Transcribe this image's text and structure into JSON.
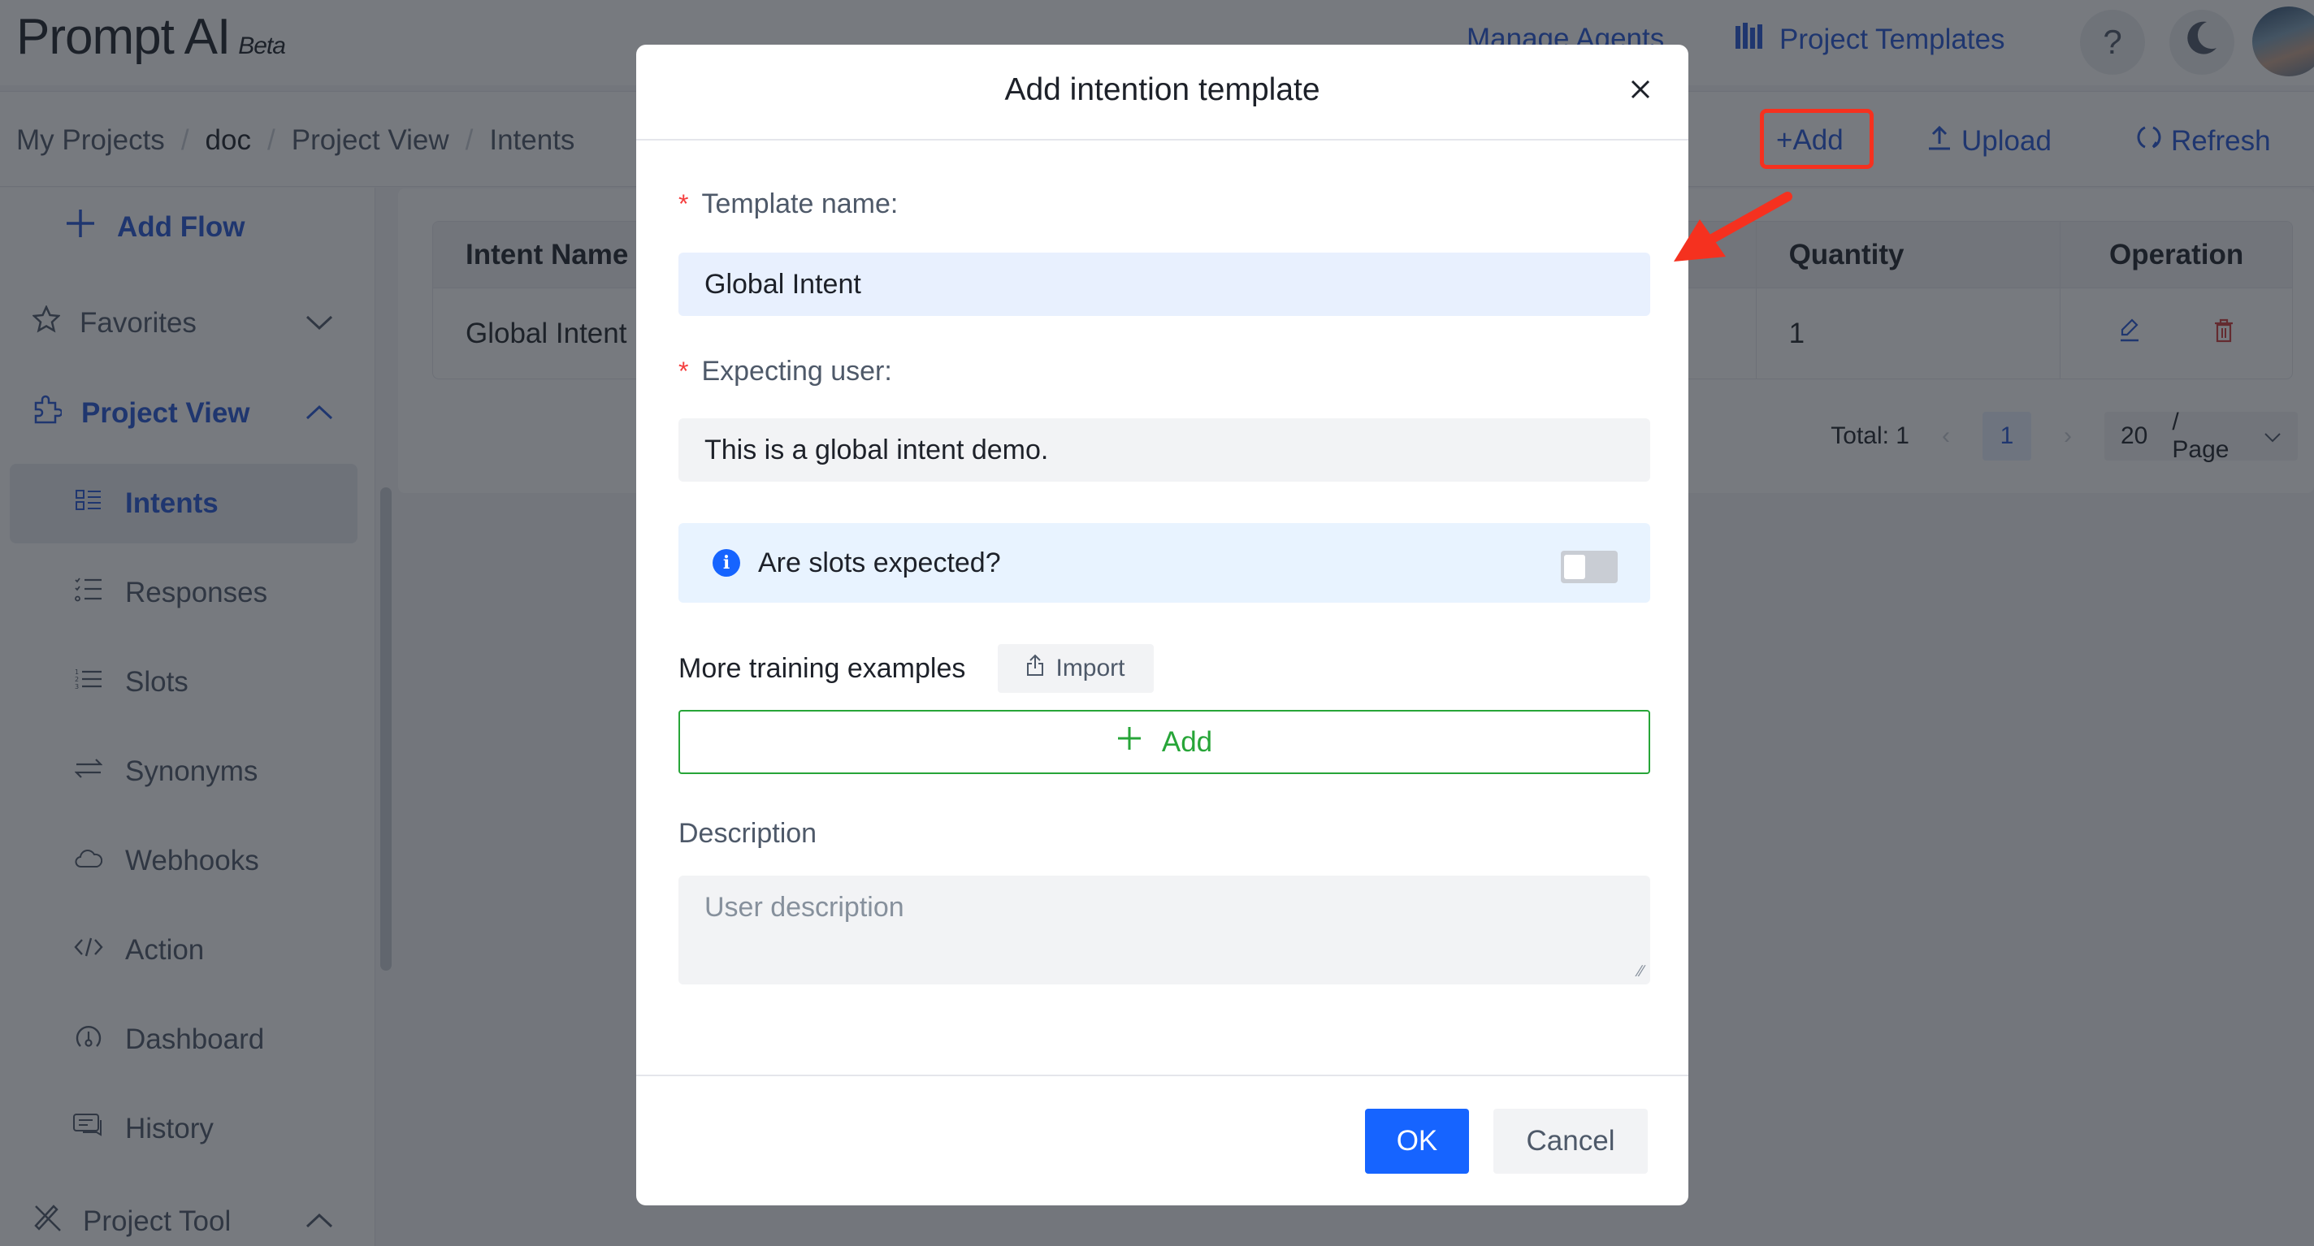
{
  "app": {
    "name": "Prompt AI",
    "badge": "Beta"
  },
  "header": {
    "manage_agents": "Manage Agents",
    "project_templates": "Project Templates",
    "help_icon": "?",
    "theme_icon": "moon-icon"
  },
  "breadcrumb": [
    "My Projects",
    "doc",
    "Project View",
    "Intents"
  ],
  "toolbar": {
    "add": "+Add",
    "upload": "Upload",
    "refresh": "Refresh"
  },
  "sidebar": {
    "add_flow": "Add Flow",
    "favorites": "Favorites",
    "project_view": "Project View",
    "items": [
      {
        "label": "Intents",
        "icon": "intents-icon",
        "active": true
      },
      {
        "label": "Responses",
        "icon": "responses-icon",
        "active": false
      },
      {
        "label": "Slots",
        "icon": "slots-icon",
        "active": false
      },
      {
        "label": "Synonyms",
        "icon": "synonyms-icon",
        "active": false
      },
      {
        "label": "Webhooks",
        "icon": "cloud-icon",
        "active": false
      },
      {
        "label": "Action",
        "icon": "code-icon",
        "active": false
      },
      {
        "label": "Dashboard",
        "icon": "dashboard-icon",
        "active": false
      },
      {
        "label": "History",
        "icon": "chat-history-icon",
        "active": false
      }
    ],
    "project_tool": "Project Tool"
  },
  "table": {
    "columns": [
      "Intent Name",
      "Quantity",
      "Operation"
    ],
    "rows": [
      {
        "name": "Global Intent",
        "quantity": "1"
      }
    ]
  },
  "pagination": {
    "total": "Total: 1",
    "current_page": "1",
    "page_size": "20",
    "page_size_suffix": "/ Page"
  },
  "modal": {
    "title": "Add intention template",
    "template_name_label": "Template name:",
    "template_name_value": "Global Intent",
    "expecting_user_label": "Expecting user:",
    "expecting_user_value": "This is a global intent demo.",
    "slots_question": "Are slots expected?",
    "slots_enabled": false,
    "training_label": "More training examples",
    "import_label": "Import",
    "add_example_label": "Add",
    "description_label": "Description",
    "description_placeholder": "User description",
    "ok_label": "OK",
    "cancel_label": "Cancel"
  },
  "colors": {
    "primary": "#1664ff",
    "link": "#2456d6",
    "success": "#27a538",
    "danger": "#f53f3f",
    "annotation": "#f5311f"
  }
}
